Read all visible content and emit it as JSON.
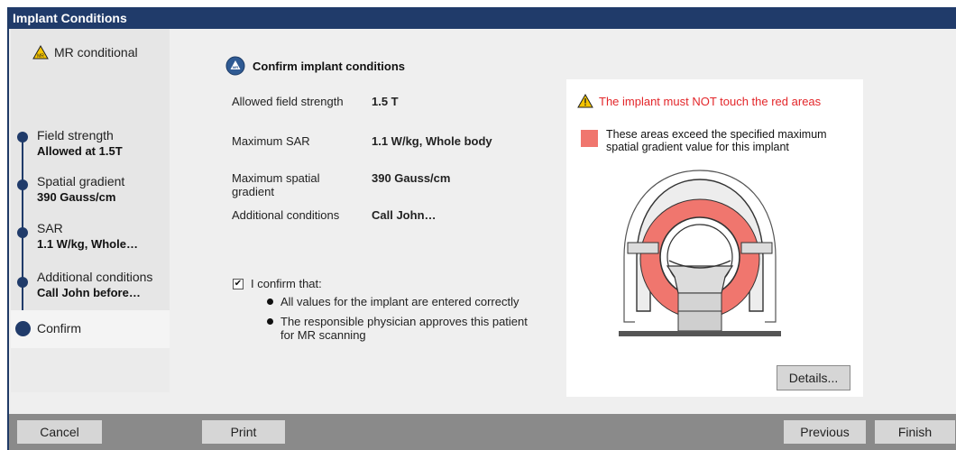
{
  "window": {
    "title": "Implant Conditions"
  },
  "sidebar": {
    "mr_conditional_label": "MR conditional",
    "mr_conditional_icon": "mr-conditional-warning-icon",
    "steps": [
      {
        "label": "Field strength",
        "value": "Allowed at 1.5T"
      },
      {
        "label": "Spatial gradient",
        "value": "390 Gauss/cm"
      },
      {
        "label": "SAR",
        "value": "1.1 W/kg, Whole…"
      },
      {
        "label": "Additional conditions",
        "value": "Call John before…"
      },
      {
        "label": "Confirm"
      }
    ]
  },
  "main": {
    "heading": "Confirm implant conditions",
    "rows": [
      {
        "label": "Allowed field strength",
        "value": "1.5 T"
      },
      {
        "label": "Maximum SAR",
        "value": "1.1 W/kg, Whole body"
      },
      {
        "label": "Maximum spatial gradient",
        "value": "390 Gauss/cm"
      },
      {
        "label": "Additional conditions",
        "value": "Call John…"
      }
    ],
    "confirm": {
      "checked": true,
      "checkbox_mark": "✔",
      "label": "I confirm that:",
      "bullets": [
        "All values for the implant are entered correctly",
        "The responsible physician approves this patient for MR scanning"
      ]
    }
  },
  "panel": {
    "warning": "The implant must NOT touch the red areas",
    "legend": "These areas exceed the specified maximum spatial gradient value for this implant",
    "legend_color": "#f0766e",
    "details_label": "Details..."
  },
  "footer": {
    "cancel": "Cancel",
    "print": "Print",
    "previous": "Previous",
    "finish": "Finish"
  },
  "colors": {
    "accent": "#203b6a",
    "warning": "#e3262a",
    "red_area": "#f0766e"
  }
}
